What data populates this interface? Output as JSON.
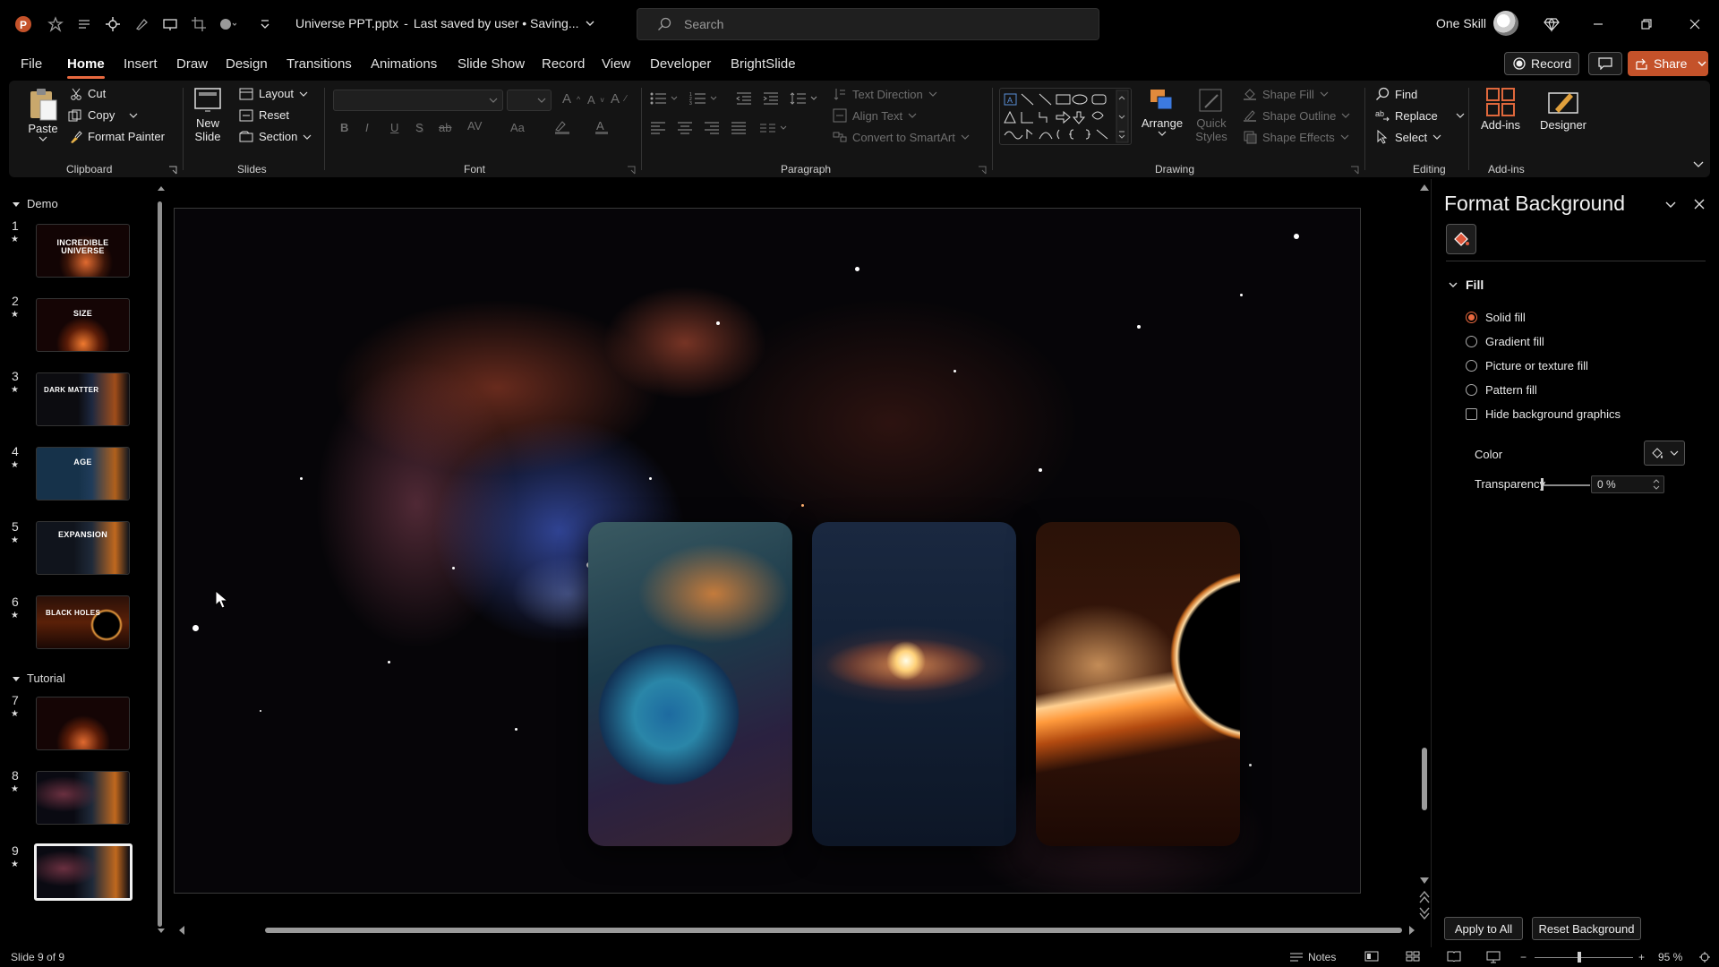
{
  "titlebar": {
    "app_icon": "powerpoint-icon",
    "file_name": "Universe PPT.pptx",
    "separator": "-",
    "save_status": "Last saved by user • Saving...",
    "search_placeholder": "Search",
    "user_name": "One Skill",
    "quick_access_icons": [
      "autosave-icon",
      "favorite-icon",
      "list-icon",
      "move-icon",
      "highlight-icon",
      "present-icon",
      "crop-icon",
      "shapes-icon",
      "customize-icon"
    ]
  },
  "menu": {
    "tabs": [
      "File",
      "Home",
      "Insert",
      "Draw",
      "Design",
      "Transitions",
      "Animations",
      "Slide Show",
      "Record",
      "View",
      "Developer",
      "BrightSlide"
    ],
    "active_tab": "Home",
    "record_label": "Record",
    "share_label": "Share"
  },
  "ribbon": {
    "clipboard": {
      "paste": "Paste",
      "cut": "Cut",
      "copy": "Copy",
      "format_painter": "Format Painter",
      "label": "Clipboard"
    },
    "slides": {
      "new_slide_line1": "New",
      "new_slide_line2": "Slide",
      "layout": "Layout",
      "reset": "Reset",
      "section": "Section",
      "label": "Slides"
    },
    "font": {
      "label": "Font",
      "buttons": [
        "B",
        "I",
        "U",
        "S",
        "ab"
      ]
    },
    "paragraph": {
      "label": "Paragraph",
      "text_direction": "Text Direction",
      "align_text": "Align Text",
      "convert_smartart": "Convert to SmartArt"
    },
    "drawing": {
      "label": "Drawing",
      "arrange": "Arrange",
      "quick_styles_line1": "Quick",
      "quick_styles_line2": "Styles",
      "shape_fill": "Shape Fill",
      "shape_outline": "Shape Outline",
      "shape_effects": "Shape Effects"
    },
    "editing": {
      "label": "Editing",
      "find": "Find",
      "replace": "Replace",
      "select": "Select"
    },
    "addins": {
      "label": "Add-ins",
      "addins_btn": "Add-ins",
      "designer": "Designer"
    }
  },
  "thumbnails": {
    "sections": [
      {
        "name": "Demo"
      },
      {
        "name": "Tutorial"
      }
    ],
    "slides": [
      {
        "num": "1",
        "title": "INCREDIBLE UNIVERSE"
      },
      {
        "num": "2",
        "title": "SIZE"
      },
      {
        "num": "3",
        "title": "DARK MATTER"
      },
      {
        "num": "4",
        "title": "AGE"
      },
      {
        "num": "5",
        "title": "EXPANSION"
      },
      {
        "num": "6",
        "title": "BLACK HOLES"
      },
      {
        "num": "7",
        "title": ""
      },
      {
        "num": "8",
        "title": ""
      },
      {
        "num": "9",
        "title": ""
      }
    ],
    "selected": "9"
  },
  "format_pane": {
    "title": "Format Background",
    "fill_section": "Fill",
    "options": [
      "Solid fill",
      "Gradient fill",
      "Picture or texture fill",
      "Pattern fill"
    ],
    "selected_option": "Solid fill",
    "hide_bg_graphics": "Hide background graphics",
    "color_label": "Color",
    "transparency_label": "Transparency",
    "transparency_value": "0 %",
    "apply_all": "Apply to All",
    "reset_bg": "Reset Background"
  },
  "status": {
    "slide_info": "Slide 9 of 9",
    "notes": "Notes",
    "zoom": "95 %",
    "minus": "−",
    "plus": "+"
  },
  "colors": {
    "accent": "#e8693f",
    "share": "#c4522a"
  }
}
